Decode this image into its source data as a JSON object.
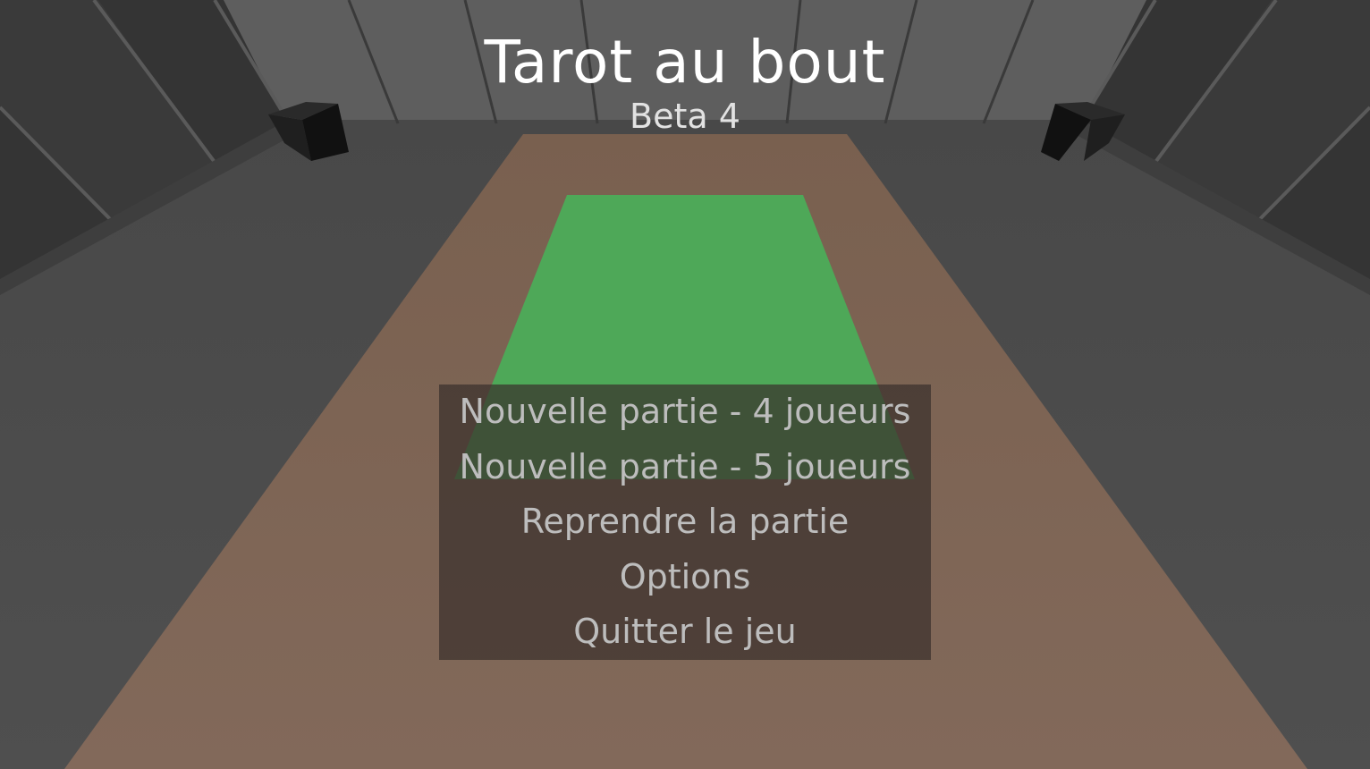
{
  "title": "Tarot au bout",
  "subtitle": "Beta 4",
  "menu": {
    "items": [
      {
        "id": "new-game-4",
        "label": "Nouvelle partie - 4 joueurs"
      },
      {
        "id": "new-game-5",
        "label": "Nouvelle partie - 5 joueurs"
      },
      {
        "id": "resume",
        "label": "Reprendre la partie"
      },
      {
        "id": "options",
        "label": "Options"
      },
      {
        "id": "quit",
        "label": "Quitter le jeu"
      }
    ]
  },
  "colors": {
    "room_floor": "#4a4a4a",
    "room_wall": "#5f5f5f",
    "carpet": "#7a6455",
    "card_mat": "#4ea858",
    "menu_panel": "#3a302d",
    "menu_text": "#bdbdbd",
    "title_text": "#ffffff"
  }
}
